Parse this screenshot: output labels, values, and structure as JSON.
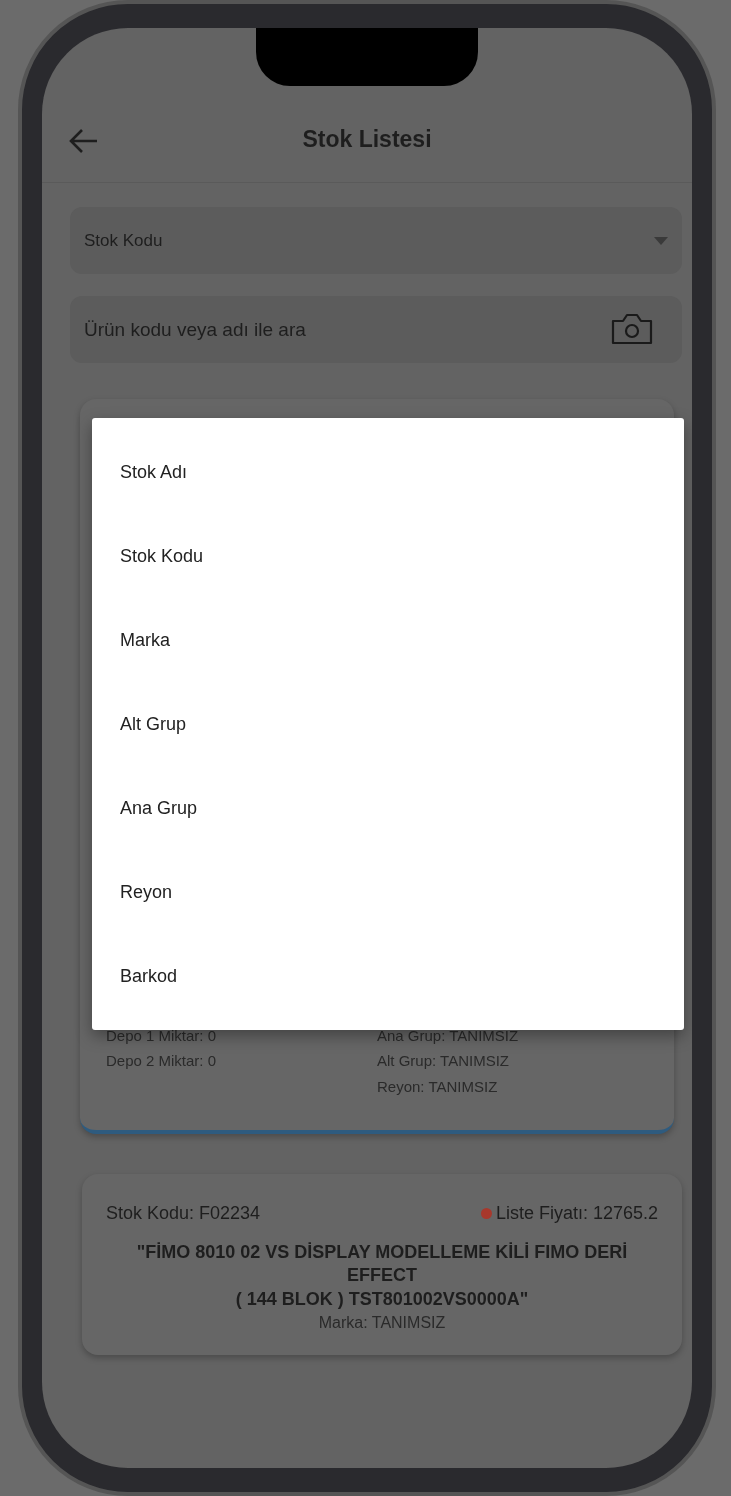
{
  "header": {
    "title": "Stok Listesi"
  },
  "filter_select": {
    "value": "Stok Kodu"
  },
  "search": {
    "placeholder": "Ürün kodu veya adı ile ara"
  },
  "products": [
    {
      "left_fields": [
        "Depo 1 Miktar: 0",
        "Depo 2 Miktar: 0"
      ],
      "right_fields": [
        "Ana Grup: TANIMSIZ",
        "Alt Grup: TANIMSIZ",
        "Reyon: TANIMSIZ"
      ],
      "selected": true
    },
    {
      "code": "Stok Kodu: F02234",
      "color": "#a8382c",
      "price": "Liste Fiyatı: 12765.2",
      "name": "\"FİMO 8010 02 VS DİSPLAY MODELLEME KİLİ FIMO DERİ EFFECT\n( 144 BLOK ) TST801002VS0000A\"",
      "brand": "Marka: TANIMSIZ",
      "selected": false
    }
  ],
  "dropdown_menu": {
    "options": [
      {
        "label": "Stok Adı",
        "selected": false
      },
      {
        "label": "Stok Kodu",
        "selected": false
      },
      {
        "label": "Marka",
        "selected": false
      },
      {
        "label": "Alt Grup",
        "selected": false
      },
      {
        "label": "Ana Grup",
        "selected": false
      },
      {
        "label": "Reyon",
        "selected": false
      },
      {
        "label": "Barkod",
        "selected": false
      }
    ]
  }
}
